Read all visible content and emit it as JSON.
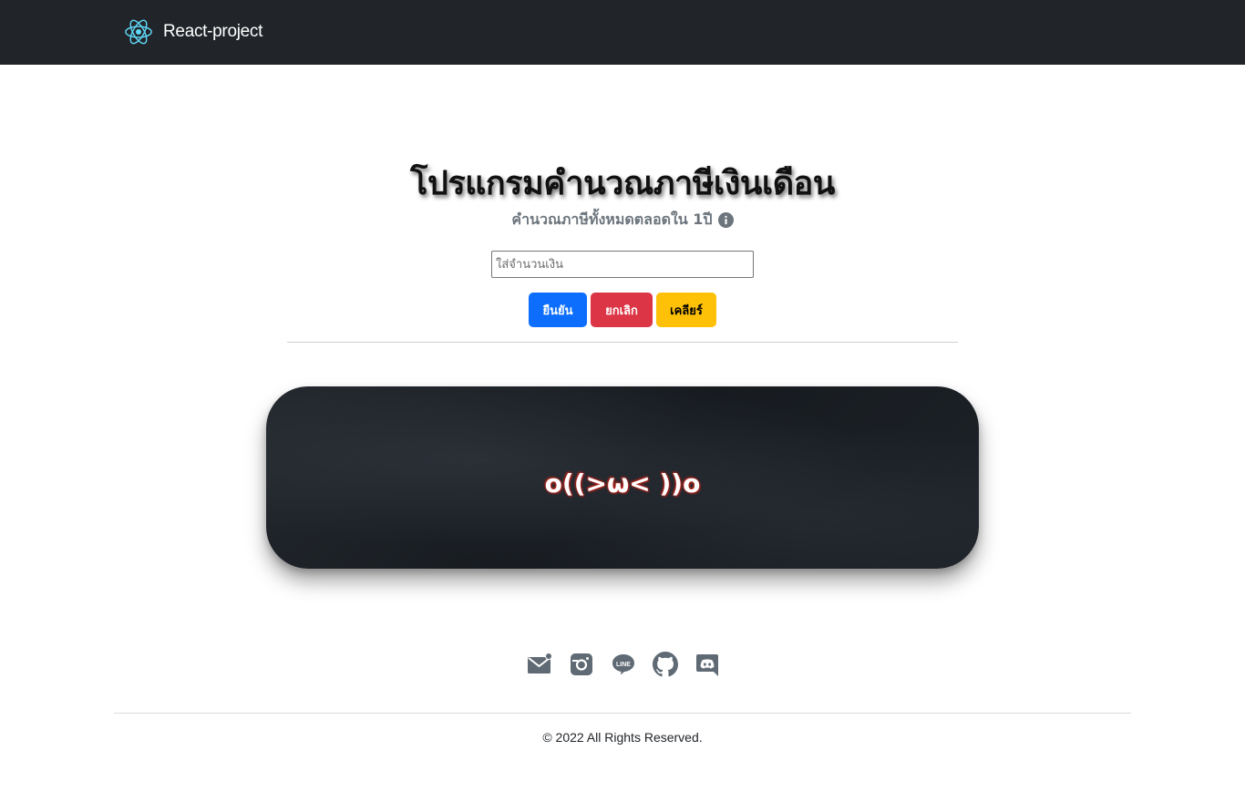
{
  "navbar": {
    "brand_text": "React-project",
    "logo_icon": "react-atom-icon",
    "logo_color": "#61dafb",
    "background": "#212529"
  },
  "header": {
    "title": "โปรแกรมคำนวณภาษีเงินเดือน",
    "subtitle": "คำนวณภาษีทั้งหมดตลอดใน 1ปี",
    "subtitle_icon": "info-circle-icon"
  },
  "form": {
    "amount_placeholder": "ใส่จำนวนเงิน",
    "amount_value": "",
    "buttons": {
      "confirm_label": "ยืนยัน",
      "cancel_label": "ยกเลิก",
      "clear_label": "เคลียร์"
    },
    "colors": {
      "confirm": "#0d6efd",
      "cancel": "#dc3545",
      "clear": "#ffc107"
    }
  },
  "result": {
    "text": "o((>ω< ))o",
    "glow_color": "#c0261c"
  },
  "footer": {
    "social_icons": [
      "mail-icon",
      "instagram-icon",
      "line-icon",
      "github-icon",
      "discord-icon"
    ],
    "icon_color": "#5f6a74",
    "copyright": "© 2022 All Rights Reserved."
  }
}
